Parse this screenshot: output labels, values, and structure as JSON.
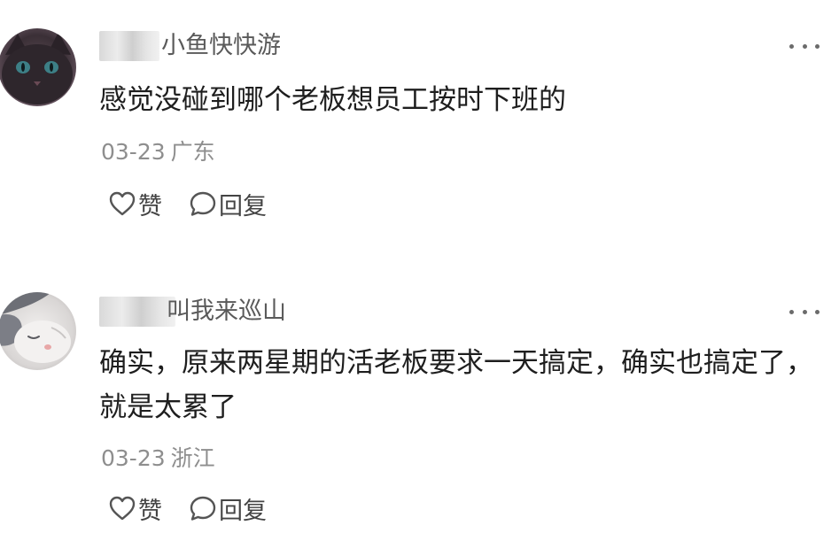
{
  "comments": [
    {
      "username": "小鱼快快游",
      "text": "感觉没碰到哪个老板想员工按时下班的",
      "date": "03-23",
      "location": "广东",
      "like_label": "赞",
      "reply_label": "回复",
      "avatar_icon": "black-cat-avatar",
      "more_icon": "more-horizontal-icon"
    },
    {
      "username": "叫我来巡山",
      "text": "确实，原来两星期的活老板要求一天搞定，确实也搞定了，就是太累了",
      "date": "03-23",
      "location": "浙江",
      "like_label": "赞",
      "reply_label": "回复",
      "avatar_icon": "sleeping-cat-avatar",
      "more_icon": "more-horizontal-icon"
    }
  ],
  "colors": {
    "text_primary": "#1e1e1e",
    "text_secondary": "#8e8e8e",
    "username": "#5a5a5a",
    "icon": "#555555"
  }
}
